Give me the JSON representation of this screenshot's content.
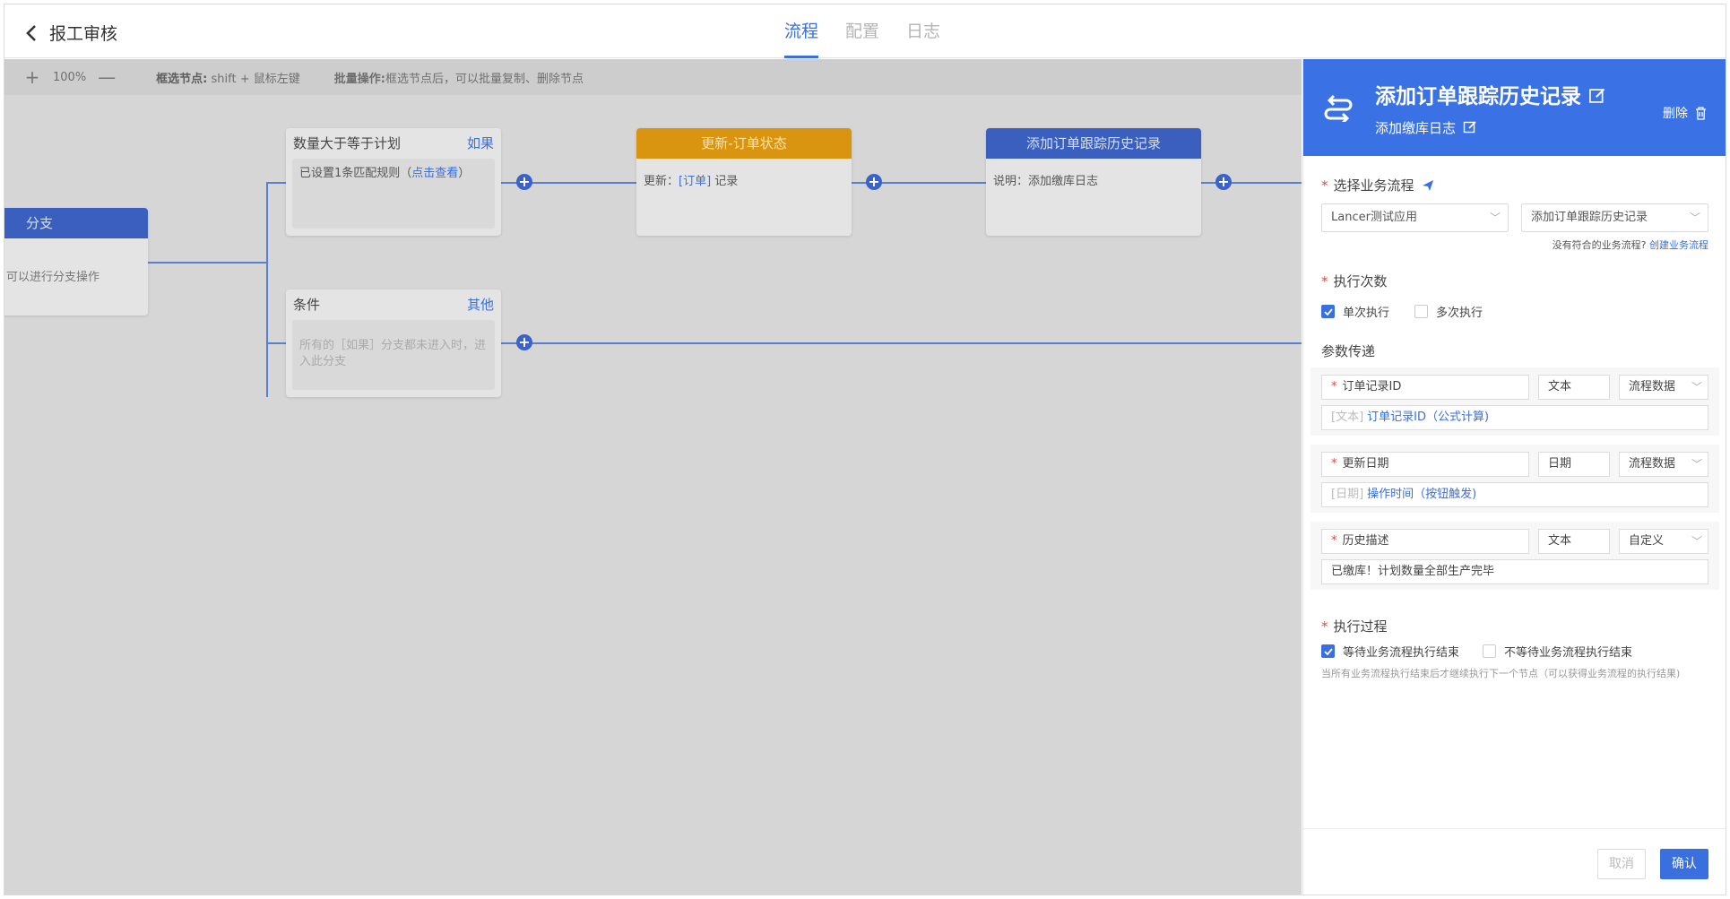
{
  "header": {
    "title": "报工审核",
    "tabs": [
      {
        "label": "流程",
        "active": true
      },
      {
        "label": "配置",
        "active": false
      },
      {
        "label": "日志",
        "active": false
      }
    ]
  },
  "toolbar": {
    "zoom_in": "+",
    "zoom_level": "100%",
    "zoom_out": "—",
    "select_hint_label": "框选节点:",
    "select_hint_value": "shift + 鼠标左键",
    "batch_hint_label": "批量操作:",
    "batch_hint_value": "框选节点后，可以批量复制、删除节点"
  },
  "canvas": {
    "branch_node": {
      "title": "分支",
      "body": "可以进行分支操作"
    },
    "if_node": {
      "title": "数量大于等于计划",
      "tag": "如果",
      "body_prefix": "已设置1条匹配规则（",
      "body_link": "点击查看",
      "body_suffix": "）"
    },
    "else_node": {
      "title": "条件",
      "tag": "其他",
      "body": "所有的［如果］分支都未进入时，进入此分支"
    },
    "update_node": {
      "title": "更新-订单状态",
      "body_prefix": "更新：",
      "body_link": "[订单]",
      "body_suffix": " 记录"
    },
    "history_node": {
      "title": "添加订单跟踪历史记录",
      "body": "说明：添加缴库日志"
    }
  },
  "panel": {
    "title": "添加订单跟踪历史记录",
    "subtitle": "添加缴库日志",
    "delete_label": "删除",
    "flow_label": "选择业务流程",
    "flow_app": "Lancer测试应用",
    "flow_name": "添加订单跟踪历史记录",
    "no_flow_hint": "没有符合的业务流程?",
    "create_flow": "创建业务流程",
    "exec_count_label": "执行次数",
    "exec_single": "单次执行",
    "exec_multi": "多次执行",
    "params_label": "参数传递",
    "params": [
      {
        "name": "订单记录ID",
        "type": "文本",
        "source": "流程数据",
        "value_tag": "[文本]",
        "value": "订单记录ID（公式计算)",
        "value_link": true
      },
      {
        "name": "更新日期",
        "type": "日期",
        "source": "流程数据",
        "value_tag": "[日期]",
        "value": "操作时间（按钮触发)",
        "value_link": true
      },
      {
        "name": "历史描述",
        "type": "文本",
        "source": "自定义",
        "value_tag": "",
        "value": "已缴库！计划数量全部生产完毕",
        "value_link": false
      }
    ],
    "process_label": "执行过程",
    "wait_label": "等待业务流程执行结束",
    "nowait_label": "不等待业务流程执行结束",
    "process_note": "当所有业务流程执行结束后才继续执行下一个节点（可以获得业务流程的执行结果)",
    "cancel": "取消",
    "confirm": "确认"
  },
  "colors": {
    "accent": "#3a6fe0",
    "panel_header": "#3a72e6",
    "orange_node": "#d9950f",
    "blue_node": "#3a5fbe"
  }
}
